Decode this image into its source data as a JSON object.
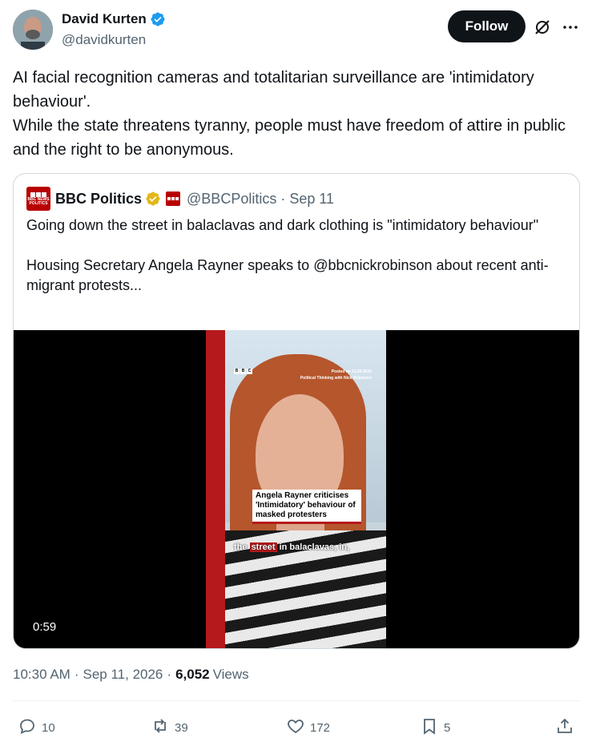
{
  "author": {
    "name": "David Kurten",
    "handle": "@davidkurten",
    "verified_color": "#1d9bf0"
  },
  "actions_header": {
    "follow_label": "Follow",
    "grok_icon": "grok-icon",
    "more_icon": "more-icon"
  },
  "tweet": {
    "lines": [
      "AI facial recognition cameras and totalitarian surveillance are 'intimidatory behaviour'.",
      "While the state threatens tyranny, people must have freedom of attire in public and the right to be anonymous."
    ]
  },
  "quote": {
    "name": "BBC Politics",
    "handle": "@BBCPolitics",
    "separator": "·",
    "date": "Sep 11",
    "avatar_text": "BBC NEWS POLITICS",
    "text_1": "Going down the street in balaclavas and dark clothing is \"intimidatory behaviour\"",
    "text_2": "Housing Secretary Angela Rayner speaks to @bbcnickrobinson about recent anti-migrant protests...",
    "gold_badge_color": "#e2b719",
    "video": {
      "duration": "0:59",
      "logo": "BBC",
      "meta_line_1": "Posted on 11.09.2025",
      "meta_line_2": "Political Thinking with Nick Robinson",
      "caption": "Angela Rayner criticises 'Intimidatory' behaviour of masked protesters",
      "subtitle_pre": "the",
      "subtitle_highlight": "street",
      "subtitle_post": "in balaclavas, in,"
    }
  },
  "meta": {
    "time": "10:30 AM",
    "dot": "·",
    "date": "Sep 11, 2026",
    "views_count": "6,052",
    "views_label": "Views"
  },
  "engagement": {
    "replies": "10",
    "reposts": "39",
    "likes": "172",
    "bookmarks": "5"
  }
}
